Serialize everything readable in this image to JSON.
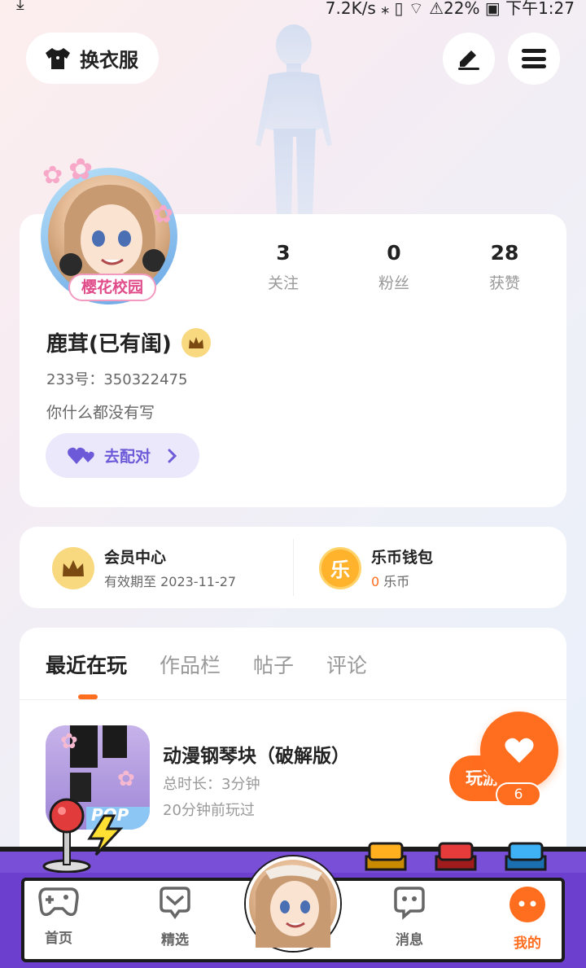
{
  "status_bar": {
    "left_icon": "download-icon",
    "right_text": "7.2K/s ⁎ ▯ ⌔ ⚠22% ▣ 下午1:27"
  },
  "header": {
    "outfit_label": "换衣服",
    "outfit_icon": "tshirt-icon",
    "edit_icon": "pen-icon",
    "menu_icon": "hamburger-menu-icon"
  },
  "profile": {
    "avatar_badge": "樱花校园",
    "stats": [
      {
        "value": "3",
        "label": "关注"
      },
      {
        "value": "0",
        "label": "粉丝"
      },
      {
        "value": "28",
        "label": "获赞"
      }
    ],
    "name": "鹿茸(已有闺)",
    "uid": "233号：350322475",
    "bio": "你什么都没有写",
    "match_label": "去配对"
  },
  "member": {
    "vip_title": "会员中心",
    "vip_sub": "有效期至 2023-11-27",
    "wallet_title": "乐币钱包",
    "wallet_amount": "0",
    "wallet_unit": "乐币",
    "wallet_icon_text": "乐"
  },
  "tabs": [
    "最近在玩",
    "作品栏",
    "帖子",
    "评论"
  ],
  "recent_game": {
    "title": "动漫钢琴块（破解版）",
    "duration": "总时长：3分钟",
    "last_played": "20分钟前玩过",
    "play_label": "玩游",
    "icon_text": "POP"
  },
  "like": {
    "count": "6"
  },
  "nav": [
    {
      "label": "首页",
      "icon": "gamepad-icon"
    },
    {
      "label": "精选",
      "icon": "heart-chat-icon"
    },
    {
      "label": "消息",
      "icon": "message-icon"
    },
    {
      "label": "我的",
      "icon": "profile-face-icon"
    }
  ],
  "colors": {
    "accent": "#ff6d1f",
    "purple": "#6c5ad8",
    "arcade": "#7a4fd8"
  }
}
